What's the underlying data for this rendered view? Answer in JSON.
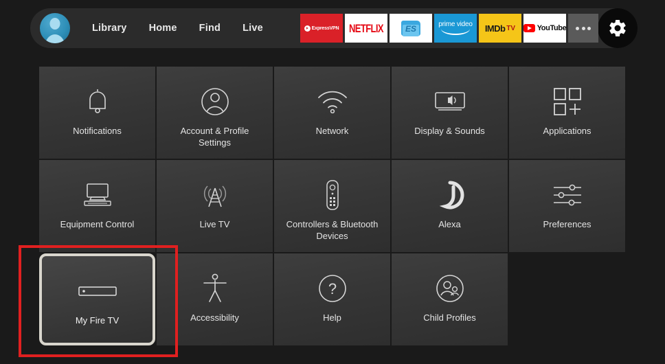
{
  "colors": {
    "background": "#1a1a1a",
    "topbar": "#2b2b2b",
    "tile": "#383838",
    "tile_text": "#e4e4e4",
    "focus_ring": "#d9d6cd",
    "annotation_red": "#e02020",
    "avatar_blue": "#2e8fb8"
  },
  "topbar": {
    "avatar": {
      "name": "user-avatar"
    },
    "nav": [
      {
        "label": "Library"
      },
      {
        "label": "Home"
      },
      {
        "label": "Find"
      },
      {
        "label": "Live"
      }
    ],
    "apps": [
      {
        "name": "expressvpn-app-icon",
        "label": "ExpressVPN"
      },
      {
        "name": "netflix-app-icon",
        "label": "NETFLIX"
      },
      {
        "name": "es-file-explorer-app-icon",
        "label": "ES"
      },
      {
        "name": "prime-video-app-icon",
        "label": "prime video"
      },
      {
        "name": "imdb-tv-app-icon",
        "label": "IMDb",
        "suffix": "TV"
      },
      {
        "name": "youtube-app-icon",
        "label": "YouTube"
      }
    ],
    "more_button": {
      "name": "more-apps-button",
      "label": "..."
    },
    "settings_button": {
      "name": "settings-gear-button",
      "label": "Settings"
    }
  },
  "grid": {
    "rows": [
      [
        {
          "label": "Notifications",
          "icon": "bell-icon",
          "focused": false
        },
        {
          "label": "Account & Profile Settings",
          "icon": "person-circle-icon",
          "focused": false
        },
        {
          "label": "Network",
          "icon": "wifi-icon",
          "focused": false
        },
        {
          "label": "Display & Sounds",
          "icon": "tv-speaker-icon",
          "focused": false
        },
        {
          "label": "Applications",
          "icon": "app-grid-plus-icon",
          "focused": false
        }
      ],
      [
        {
          "label": "Equipment Control",
          "icon": "tv-equipment-icon",
          "focused": false
        },
        {
          "label": "Live TV",
          "icon": "broadcast-tower-icon",
          "focused": false
        },
        {
          "label": "Controllers & Bluetooth Devices",
          "icon": "remote-control-icon",
          "focused": false
        },
        {
          "label": "Alexa",
          "icon": "alexa-ring-icon",
          "focused": false
        },
        {
          "label": "Preferences",
          "icon": "sliders-icon",
          "focused": false
        }
      ],
      [
        {
          "label": "My Fire TV",
          "icon": "fire-tv-stick-icon",
          "focused": true
        },
        {
          "label": "Accessibility",
          "icon": "accessibility-person-icon",
          "focused": false
        },
        {
          "label": "Help",
          "icon": "question-circle-icon",
          "focused": false
        },
        {
          "label": "Child Profiles",
          "icon": "child-profiles-icon",
          "focused": false
        }
      ]
    ]
  },
  "annotation": {
    "name": "highlight-rectangle",
    "target": "My Fire TV"
  }
}
